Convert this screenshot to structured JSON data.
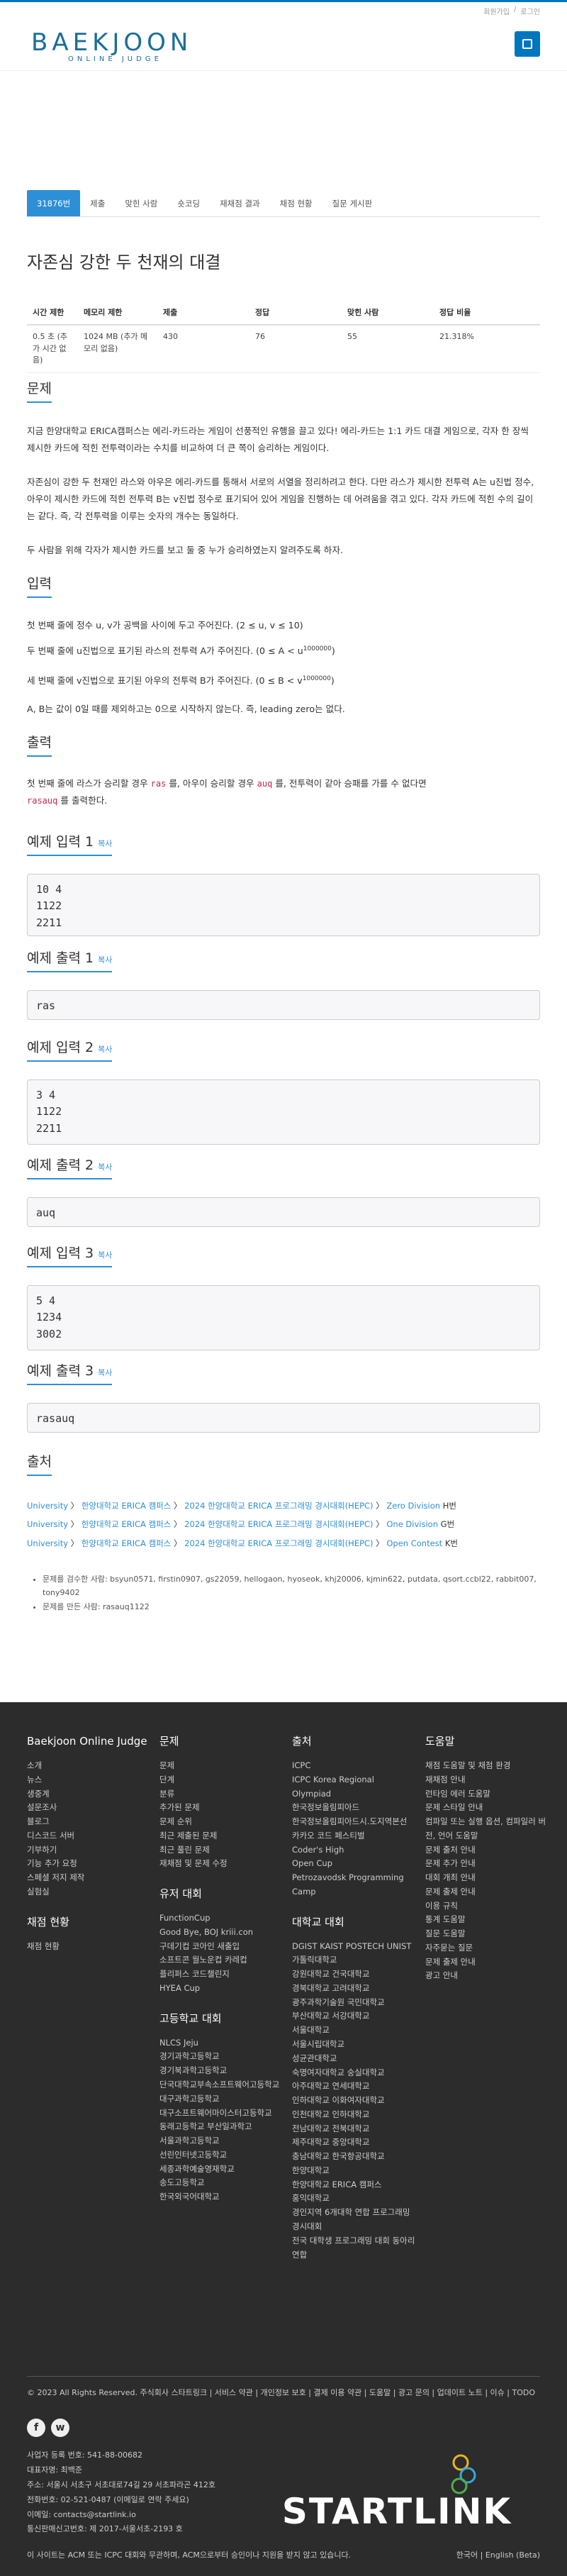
{
  "top_links": [
    "회원가입",
    "로그인"
  ],
  "logo": {
    "main": "BAEKJOON",
    "sub": "ONLINE JUDGE"
  },
  "tabs": [
    {
      "label": "31876번",
      "active": true
    },
    {
      "label": "제출"
    },
    {
      "label": "맞힌 사람"
    },
    {
      "label": "숏코딩"
    },
    {
      "label": "재채점 결과"
    },
    {
      "label": "채점 현황"
    },
    {
      "label": "질문 게시판"
    }
  ],
  "problem_title": "자존심 강한 두 천재의 대결",
  "info": {
    "headers": [
      "시간 제한",
      "메모리 제한",
      "제출",
      "정답",
      "맞힌 사람",
      "정답 비율"
    ],
    "values": [
      "0.5 초 (추가 시간 없음)",
      "1024 MB (추가 메모리 없음)",
      "430",
      "76",
      "55",
      "21.318%"
    ]
  },
  "sections": {
    "problem": "문제",
    "input": "입력",
    "output": "출력",
    "sample_in_1": "예제 입력 1",
    "sample_out_1": "예제 출력 1",
    "sample_in_2": "예제 입력 2",
    "sample_out_2": "예제 출력 2",
    "sample_in_3": "예제 입력 3",
    "sample_out_3": "예제 출력 3",
    "source": "출처",
    "copy": "복사"
  },
  "problem_text": {
    "p1": "지금 한양대학교 ERICA캠퍼스는 에리-카드라는 게임이 선풍적인 유행을 끌고 있다! 에리-카드는 1:1 카드 대결 게임으로, 각자 한 장씩 제시한 카드에 적힌 전투력이라는 수치를 비교하여 더 큰 쪽이 승리하는 게임이다.",
    "p2": "자존심이 강한 두 천재인 라스와 아우은 에리-카드를 통해서 서로의 서열을 정리하려고 한다. 다만 라스가 제시한 전투력 A는 u진법 정수, 아우이 제시한 카드에 적힌 전투력 B는 v진법 정수로 표기되어 있어 게임을 진행하는 데 어려움을 겪고 있다. 각자 카드에 적힌 수의 길이는 같다. 즉, 각 전투력을 이루는 숫자의 개수는 동일하다.",
    "p3": "두 사람을 위해 각자가 제시한 카드를 보고 둘 중 누가 승리하였는지 알려주도록 하자."
  },
  "input_text": {
    "l1": "첫 번째 줄에 정수 u, v가 공백을 사이에 두고 주어진다. (2 ≤ u, v ≤ 10)",
    "l2a": "두 번째 줄에 u진법으로 표기된 라스의 전투력 A가 주어진다. (0 ≤ A < u",
    "l2sup": "1000000",
    "l3a": "세 번째 줄에 v진법으로 표기된 아우의 전투력 B가 주어진다. (0 ≤ B < v",
    "l3sup": "1000000",
    "close": ")",
    "l4": "A, B는 값이 0일 때를 제외하고는 0으로 시작하지 않는다. 즉, leading zero는 없다."
  },
  "output_text": {
    "a": "첫 번째 줄에 라스가 승리할 경우 ",
    "ras": "ras",
    "b": " 를, 아우이 승리할 경우 ",
    "auq": "auq",
    "c": " 를, 전투력이 같아 승패를 가를 수 없다면",
    "rasauq": "rasauq",
    "d": " 를 출력한다."
  },
  "samples": {
    "in1": "10 4\n1122\n2211",
    "out1": "ras",
    "in2": "3 4\n1122\n2211",
    "out2": "auq",
    "in3": "5 4\n1234\n3002",
    "out3": "rasauq"
  },
  "source": [
    {
      "a": "University",
      "b": "한양대학교 ERICA 캠퍼스",
      "c": "2024 한양대학교 ERICA 프로그래밍 경시대회(HEPC)",
      "d": "Zero Division",
      "e": "H번"
    },
    {
      "a": "University",
      "b": "한양대학교 ERICA 캠퍼스",
      "c": "2024 한양대학교 ERICA 프로그래밍 경시대회(HEPC)",
      "d": "One Division",
      "e": "G번"
    },
    {
      "a": "University",
      "b": "한양대학교 ERICA 캠퍼스",
      "c": "2024 한양대학교 ERICA 프로그래밍 경시대회(HEPC)",
      "d": "Open Contest",
      "e": "K번"
    }
  ],
  "credits": {
    "checkers": "문제를 검수한 사람: bsyun0571, firstin0907, gs22059, hellogaon, hyoseok, khj20006, kjmin622, putdata, qsort.ccbl22, rabbit007, tony9402",
    "author": "문제를 만든 사람: rasauq1122"
  },
  "footer": {
    "col1_title": "Baekjoon Online Judge",
    "col1": [
      "소개",
      "뉴스",
      "생중계",
      "설문조사",
      "블로그",
      "디스코드 서버",
      "기부하기",
      "기능 추가 요청",
      "스페셜 저지 제작",
      "실험실"
    ],
    "col1b_title": "채점 현황",
    "col1b": [
      "채점 현황"
    ],
    "col2_title": "문제",
    "col2": [
      "문제",
      "단계",
      "분류",
      "추가된 문제",
      "문제 순위",
      "최근 제출된 문제",
      "최근 풀린 문제",
      "재채점 및 문제 수정"
    ],
    "col2b_title": "유저 대회",
    "col2b": [
      "FunctionCup",
      "Good Bye, BOJ kriii.con",
      "구데기컵 코아인 새출입",
      "소프트콘 월노운컵 카레컵",
      "플리퍼스 코드챌린지",
      "HYEA Cup"
    ],
    "col2c_title": "고등학교 대회",
    "col2c": [
      "NLCS Jeju",
      "경기과학고등학교",
      "경기북과학고등학교",
      "단국대학교부속소프트웨어고등학교",
      "대구과학고등학교",
      "대구소프트웨어마이스터고등학교",
      "동래고등학교 부산일과학고",
      "서울과학고등학교",
      "선린인터넷고등학교",
      "세종과학예술영재학교",
      "송도고등학교",
      "한국외국어대학교"
    ],
    "col3_title": "출처",
    "col3": [
      "ICPC",
      "ICPC Korea Regional",
      "Olympiad",
      "한국정보올림피아드",
      "한국정보올림피아드시.도지역본선",
      "카카오 코드 페스티벌",
      "Coder's High",
      "Open Cup",
      "Petrozavodsk Programming Camp"
    ],
    "col3b_title": "대학교 대회",
    "col3b": [
      "DGIST KAIST POSTECH UNIST 가톨릭대학교",
      "강원대학교 건국대학교",
      "경북대학교 고려대학교",
      "광주과학기술원 국민대학교",
      "부산대학교 서강대학교",
      "서울대학교",
      "서울시립대학교",
      "성균관대학교",
      "숙명여자대학교 숭실대학교",
      "아주대학교 연세대학교",
      "인하대학교 이화여자대학교",
      "인천대학교 인하대학교",
      "전남대학교 전북대학교",
      "제주대학교 중앙대학교",
      "충남대학교 한국항공대학교",
      "한양대학교",
      "한양대학교 ERICA 캠퍼스",
      "홍익대학교",
      "경인지역 6개대학 연합 프로그래밍 경시대회",
      "전국 대학생 프로그래밍 대회 동아리 연합"
    ],
    "col4_title": "도움말",
    "col4": [
      "채점 도움말 및 채점 환경",
      "재채점 안내",
      "런타임 에러 도움말",
      "문제 스타일 안내",
      "컴파일 또는 실행 옵션, 컴파일러 버전, 언어 도움말",
      "문제 출처 안내",
      "문제 추가 안내",
      "대회 개최 안내",
      "문제 출제 안내",
      "이용 규칙",
      "통계 도움말",
      "질문 도움말",
      "자주묻는 질문",
      "문제 출제 안내",
      "광고 안내"
    ],
    "bottom_links": "© 2023 All Rights Reserved. 주식회사 스타트링크 | 서비스 약관 | 개인정보 보호 | 결제 이용 약관 | 도움말 | 광고 문의 | 업데이트 노트 | 이슈 | TODO",
    "social": [
      "f",
      "w"
    ],
    "company": [
      "사업자 등록 번호: 541-88-00682",
      "대표자명: 최백준",
      "주소: 서울시 서초구 서초대로74길 29 서초파라곤 412호",
      "전화번호: 02-521-0487 (이메일로 연락 주세요)",
      "이메일: contacts@startlink.io",
      "통신판매신고번호: 제 2017-서울서초-2193 호"
    ],
    "startlink": "STARTLINK",
    "disclaimer": "이 사이트는 ACM 또는 ICPC 대회와 무관하며, ACM으로부터 승인이나 지원을 받지 않고 있습니다.",
    "lang": "한국어 | English (Beta)"
  }
}
